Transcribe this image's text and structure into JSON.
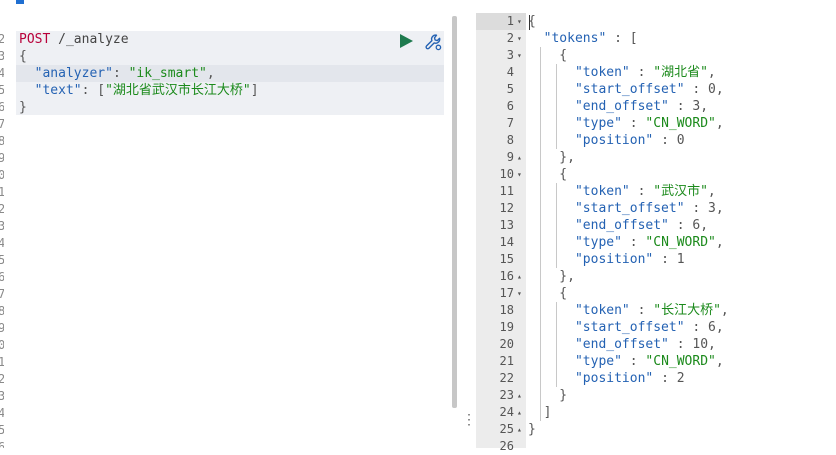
{
  "request": {
    "method": "POST",
    "path": " /_analyze",
    "lines": [
      {
        "segs": [
          {
            "t": "{",
            "c": "c-punc"
          }
        ]
      },
      {
        "segs": [
          {
            "t": "  ",
            "c": ""
          },
          {
            "t": "\"analyzer\"",
            "c": "c-key"
          },
          {
            "t": ": ",
            "c": "c-punc"
          },
          {
            "t": "\"ik_smart\"",
            "c": "c-str"
          },
          {
            "t": ",",
            "c": "c-punc"
          }
        ]
      },
      {
        "segs": [
          {
            "t": "  ",
            "c": ""
          },
          {
            "t": "\"text\"",
            "c": "c-key"
          },
          {
            "t": ": [",
            "c": "c-punc"
          },
          {
            "t": "\"湖北省武汉市长江大桥\"",
            "c": "c-str"
          },
          {
            "t": "]",
            "c": "c-punc"
          }
        ]
      },
      {
        "segs": [
          {
            "t": "}",
            "c": "c-punc"
          }
        ]
      }
    ]
  },
  "left_gutter_fragments": [
    "2",
    "3",
    "4",
    "5",
    "6",
    "7",
    "8",
    "9",
    "0",
    "1",
    "2",
    "3",
    "4",
    "5",
    "6",
    "7",
    "8",
    "9",
    "0",
    "1",
    "2",
    "3",
    "4",
    "5",
    "6"
  ],
  "actions": {
    "play_icon": "play-icon",
    "wrench_icon": "wrench-icon"
  },
  "response": {
    "line_numbers": [
      "1",
      "2",
      "3",
      "4",
      "5",
      "6",
      "7",
      "8",
      "9",
      "10",
      "11",
      "12",
      "13",
      "14",
      "15",
      "16",
      "17",
      "18",
      "19",
      "20",
      "21",
      "22",
      "23",
      "24",
      "25",
      "26"
    ],
    "folds": [
      {
        "line": 1,
        "dir": "down"
      },
      {
        "line": 2,
        "dir": "down"
      },
      {
        "line": 3,
        "dir": "down"
      },
      {
        "line": 9,
        "dir": "up"
      },
      {
        "line": 10,
        "dir": "down"
      },
      {
        "line": 16,
        "dir": "up"
      },
      {
        "line": 17,
        "dir": "down"
      },
      {
        "line": 23,
        "dir": "up"
      },
      {
        "line": 24,
        "dir": "up"
      },
      {
        "line": 25,
        "dir": "up"
      }
    ],
    "lines": [
      {
        "segs": [
          {
            "t": "{",
            "c": "c-punc"
          }
        ]
      },
      {
        "segs": [
          {
            "t": "  ",
            "c": ""
          },
          {
            "t": "\"tokens\"",
            "c": "c-key"
          },
          {
            "t": " : [",
            "c": "c-punc"
          }
        ]
      },
      {
        "segs": [
          {
            "t": "    {",
            "c": "c-punc"
          }
        ]
      },
      {
        "segs": [
          {
            "t": "      ",
            "c": ""
          },
          {
            "t": "\"token\"",
            "c": "c-key"
          },
          {
            "t": " : ",
            "c": "c-punc"
          },
          {
            "t": "\"湖北省\"",
            "c": "c-str"
          },
          {
            "t": ",",
            "c": "c-punc"
          }
        ]
      },
      {
        "segs": [
          {
            "t": "      ",
            "c": ""
          },
          {
            "t": "\"start_offset\"",
            "c": "c-key"
          },
          {
            "t": " : 0,",
            "c": "c-punc"
          }
        ]
      },
      {
        "segs": [
          {
            "t": "      ",
            "c": ""
          },
          {
            "t": "\"end_offset\"",
            "c": "c-key"
          },
          {
            "t": " : 3,",
            "c": "c-punc"
          }
        ]
      },
      {
        "segs": [
          {
            "t": "      ",
            "c": ""
          },
          {
            "t": "\"type\"",
            "c": "c-key"
          },
          {
            "t": " : ",
            "c": "c-punc"
          },
          {
            "t": "\"CN_WORD\"",
            "c": "c-str"
          },
          {
            "t": ",",
            "c": "c-punc"
          }
        ]
      },
      {
        "segs": [
          {
            "t": "      ",
            "c": ""
          },
          {
            "t": "\"position\"",
            "c": "c-key"
          },
          {
            "t": " : 0",
            "c": "c-punc"
          }
        ]
      },
      {
        "segs": [
          {
            "t": "    },",
            "c": "c-punc"
          }
        ]
      },
      {
        "segs": [
          {
            "t": "    {",
            "c": "c-punc"
          }
        ]
      },
      {
        "segs": [
          {
            "t": "      ",
            "c": ""
          },
          {
            "t": "\"token\"",
            "c": "c-key"
          },
          {
            "t": " : ",
            "c": "c-punc"
          },
          {
            "t": "\"武汉市\"",
            "c": "c-str"
          },
          {
            "t": ",",
            "c": "c-punc"
          }
        ]
      },
      {
        "segs": [
          {
            "t": "      ",
            "c": ""
          },
          {
            "t": "\"start_offset\"",
            "c": "c-key"
          },
          {
            "t": " : 3,",
            "c": "c-punc"
          }
        ]
      },
      {
        "segs": [
          {
            "t": "      ",
            "c": ""
          },
          {
            "t": "\"end_offset\"",
            "c": "c-key"
          },
          {
            "t": " : 6,",
            "c": "c-punc"
          }
        ]
      },
      {
        "segs": [
          {
            "t": "      ",
            "c": ""
          },
          {
            "t": "\"type\"",
            "c": "c-key"
          },
          {
            "t": " : ",
            "c": "c-punc"
          },
          {
            "t": "\"CN_WORD\"",
            "c": "c-str"
          },
          {
            "t": ",",
            "c": "c-punc"
          }
        ]
      },
      {
        "segs": [
          {
            "t": "      ",
            "c": ""
          },
          {
            "t": "\"position\"",
            "c": "c-key"
          },
          {
            "t": " : 1",
            "c": "c-punc"
          }
        ]
      },
      {
        "segs": [
          {
            "t": "    },",
            "c": "c-punc"
          }
        ]
      },
      {
        "segs": [
          {
            "t": "    {",
            "c": "c-punc"
          }
        ]
      },
      {
        "segs": [
          {
            "t": "      ",
            "c": ""
          },
          {
            "t": "\"token\"",
            "c": "c-key"
          },
          {
            "t": " : ",
            "c": "c-punc"
          },
          {
            "t": "\"长江大桥\"",
            "c": "c-str"
          },
          {
            "t": ",",
            "c": "c-punc"
          }
        ]
      },
      {
        "segs": [
          {
            "t": "      ",
            "c": ""
          },
          {
            "t": "\"start_offset\"",
            "c": "c-key"
          },
          {
            "t": " : 6,",
            "c": "c-punc"
          }
        ]
      },
      {
        "segs": [
          {
            "t": "      ",
            "c": ""
          },
          {
            "t": "\"end_offset\"",
            "c": "c-key"
          },
          {
            "t": " : 10,",
            "c": "c-punc"
          }
        ]
      },
      {
        "segs": [
          {
            "t": "      ",
            "c": ""
          },
          {
            "t": "\"type\"",
            "c": "c-key"
          },
          {
            "t": " : ",
            "c": "c-punc"
          },
          {
            "t": "\"CN_WORD\"",
            "c": "c-str"
          },
          {
            "t": ",",
            "c": "c-punc"
          }
        ]
      },
      {
        "segs": [
          {
            "t": "      ",
            "c": ""
          },
          {
            "t": "\"position\"",
            "c": "c-key"
          },
          {
            "t": " : 2",
            "c": "c-punc"
          }
        ]
      },
      {
        "segs": [
          {
            "t": "    }",
            "c": "c-punc"
          }
        ]
      },
      {
        "segs": [
          {
            "t": "  ]",
            "c": "c-punc"
          }
        ]
      },
      {
        "segs": [
          {
            "t": "}",
            "c": "c-punc"
          }
        ]
      },
      {
        "segs": []
      }
    ]
  },
  "colors": {
    "accent": "#1f6fd1",
    "method": "#b8003a",
    "key": "#2462b3",
    "string": "#1b8a1b",
    "play": "#1e7a4e"
  }
}
